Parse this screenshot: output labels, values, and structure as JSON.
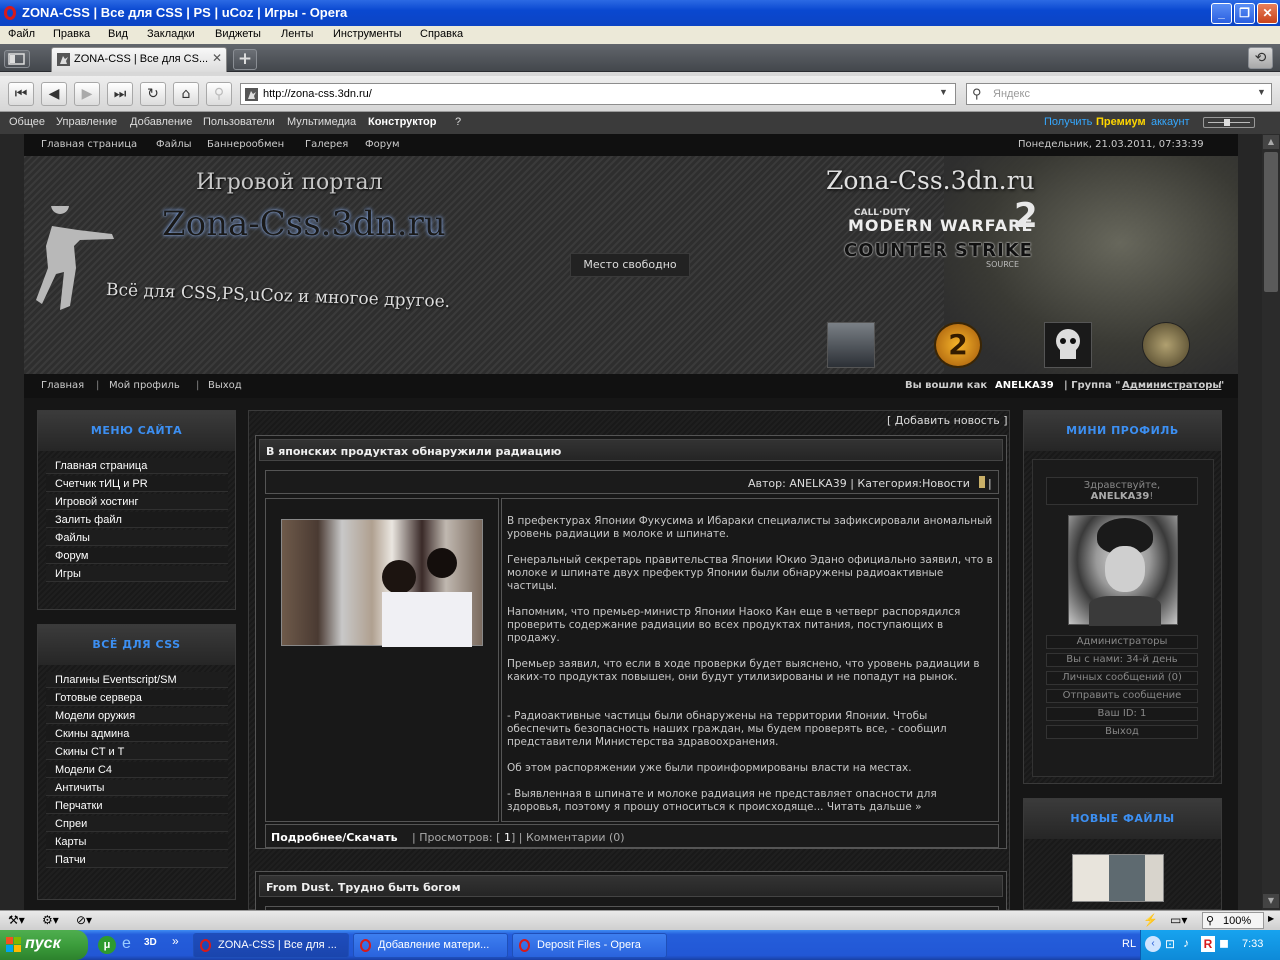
{
  "window": {
    "title": "ZONA-CSS | Все для CSS | PS | uCoz | Игры - Opera"
  },
  "menubar": [
    "Файл",
    "Правка",
    "Вид",
    "Закладки",
    "Виджеты",
    "Ленты",
    "Инструменты",
    "Справка"
  ],
  "tab": {
    "label": "ZONA-CSS | Все для CS..."
  },
  "address": {
    "url": "http://zona-css.3dn.ru/",
    "search_placeholder": "Яндекс"
  },
  "ucoz_panel": {
    "items": [
      "Общее",
      "Управление",
      "Добавление",
      "Пользователи",
      "Мультимедиа",
      "Конструктор",
      "?"
    ],
    "premium_prefix": "Получить",
    "premium_word": "Премиум",
    "premium_suffix": "аккаунт"
  },
  "site": {
    "topnav": [
      "Главная страница",
      "Файлы",
      "Баннерообмен",
      "Галерея",
      "Форум"
    ],
    "datetime": "Понедельник, 21.03.2011, 07:33:39",
    "header": {
      "title_small": "Игровой портал",
      "title_big": "Zona-Css.3dn.ru",
      "tagline": "Всё для CSS,PS,uCoz и многое другое.",
      "right_title": "Zona-Css.3dn.ru",
      "cod_small": "CALL·DUTY",
      "cod_big": "MODERN WARFARE",
      "cs_logo": "COUNTER STRIKE",
      "cs_sub": "SOURCE",
      "ad_slot": "Место свободно"
    },
    "subnav": [
      "Главная",
      "Мой профиль",
      "Выход"
    ],
    "login": {
      "prefix": "Вы вошли как",
      "user": "ANELKA39",
      "group_prefix": "| Группа \"",
      "group": "Администраторы",
      "group_suffix": "\""
    }
  },
  "left_menu": {
    "title": "МЕНЮ САЙТА",
    "items": [
      "Главная страница",
      "Счетчик тИЦ и PR",
      "Игровой хостинг",
      "Залить файл",
      "Файлы",
      "Форум",
      "Игры"
    ]
  },
  "css_menu": {
    "title": "ВСЁ ДЛЯ CSS",
    "items": [
      "Плагины Eventscript/SM",
      "Готовые сервера",
      "Модели оружия",
      "Скины админа",
      "Скины CT и T",
      "Модели C4",
      "Античиты",
      "Перчатки",
      "Спреи",
      "Карты",
      "Патчи"
    ]
  },
  "news": {
    "add_link": "[ Добавить новость ]",
    "title": "В японских продуктах обнаружили радиацию",
    "meta": "Автор: ANELKA39 | Категория:Новости",
    "paragraphs": [
      "В префектурах Японии Фукусима и Ибараки специалисты зафиксировали аномальный уровень радиации в молоке и шпинате.",
      "Генеральный секретарь правительства Японии Юкио Эдано официально заявил, что в молоке и шпинате двух префектур Японии были обнаружены радиоактивные частицы.",
      "Напомним, что премьер-министр Японии Наоко Кан еще в четверг распорядился проверить содержание радиации во всех продуктах питания, поступающих в продажу.",
      "Премьер заявил, что если в ходе проверки будет выяснено, что уровень радиации в каких-то продуктах повышен, они будут утилизированы и не попадут на рынок.",
      "- Радиоактивные частицы были обнаружены на территории Японии. Чтобы обеспечить безопасность наших граждан, мы будем проверять все, - сообщил представители Министерства здравоохранения.",
      "Об этом распоряжении уже были проинформированы власти на местах.",
      "- Выявленная в шпинате и молоке радиация не представляет опасности для здоровья, поэтому я прошу относиться к происходяще... Читать дальше »"
    ],
    "more_link": "Подробнее/Скачать",
    "views_label": "| Просмотров: [",
    "views_value": "1",
    "views_suffix": "] | Комментарии (0)",
    "next_title": "From Dust. Трудно быть богом"
  },
  "mini_profile": {
    "title": "МИНИ ПРОФИЛЬ",
    "greeting": "Здравствуйте,",
    "user": "ANELKA39",
    "user_suffix": "!",
    "rows": [
      "Администраторы",
      "Вы с нами: 34-й день",
      "Личных сообщений (0)",
      "Отправить сообщение",
      "Ваш ID: 1",
      "Выход"
    ]
  },
  "new_files": {
    "title": "НОВЫЕ ФАЙЛЫ"
  },
  "status": {
    "zoom": "100%"
  },
  "taskbar": {
    "start": "пуск",
    "tasks": [
      "ZONA-CSS | Все для ...",
      "Добавление матери...",
      "Deposit Files - Opera"
    ],
    "lang": "RL",
    "time": "7:33"
  }
}
